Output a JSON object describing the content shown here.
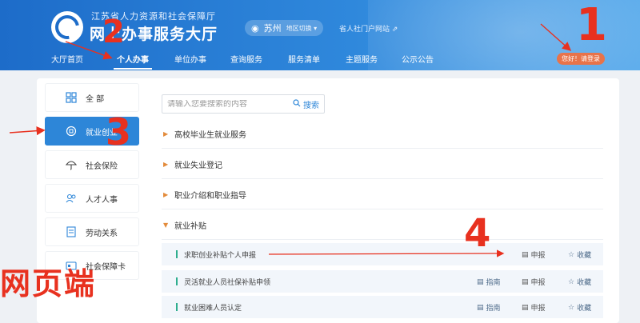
{
  "header": {
    "org": "江苏省人力资源和社会保障厅",
    "hall": "网上办事服务大厅",
    "city": "苏州",
    "city_switch": "地区切换 ▾",
    "portal_link": "省人社门户网站",
    "login": "您好！请登录"
  },
  "nav": [
    "大厅首页",
    "个人办事",
    "单位办事",
    "查询服务",
    "服务清单",
    "主题服务",
    "公示公告"
  ],
  "sidebar": [
    {
      "label": "全 部",
      "icon": "grid-icon"
    },
    {
      "label": "就业创业",
      "icon": "briefcase-icon"
    },
    {
      "label": "社会保险",
      "icon": "umbrella-icon"
    },
    {
      "label": "人才人事",
      "icon": "people-icon"
    },
    {
      "label": "劳动关系",
      "icon": "document-icon"
    },
    {
      "label": "社会保障卡",
      "icon": "card-icon"
    }
  ],
  "search": {
    "placeholder": "请输入您要搜索的内容",
    "button": "搜索"
  },
  "groups": [
    {
      "label": "高校毕业生就业服务",
      "arrow": "▶"
    },
    {
      "label": "就业失业登记",
      "arrow": "▶"
    },
    {
      "label": "职业介绍和职业指导",
      "arrow": "▶"
    },
    {
      "label": "就业补贴",
      "arrow": "▼"
    }
  ],
  "items": [
    {
      "label": "求职创业补贴个人申报"
    },
    {
      "label": "灵活就业人员社保补贴申领"
    },
    {
      "label": "就业困难人员认定"
    }
  ],
  "actions": {
    "guide": "指南",
    "apply": "申报",
    "favorite": "收藏"
  },
  "annotations": {
    "n1": "1",
    "n2": "2",
    "n3": "3",
    "n4": "4",
    "caption": "网页端",
    "color": "#e8311f"
  }
}
